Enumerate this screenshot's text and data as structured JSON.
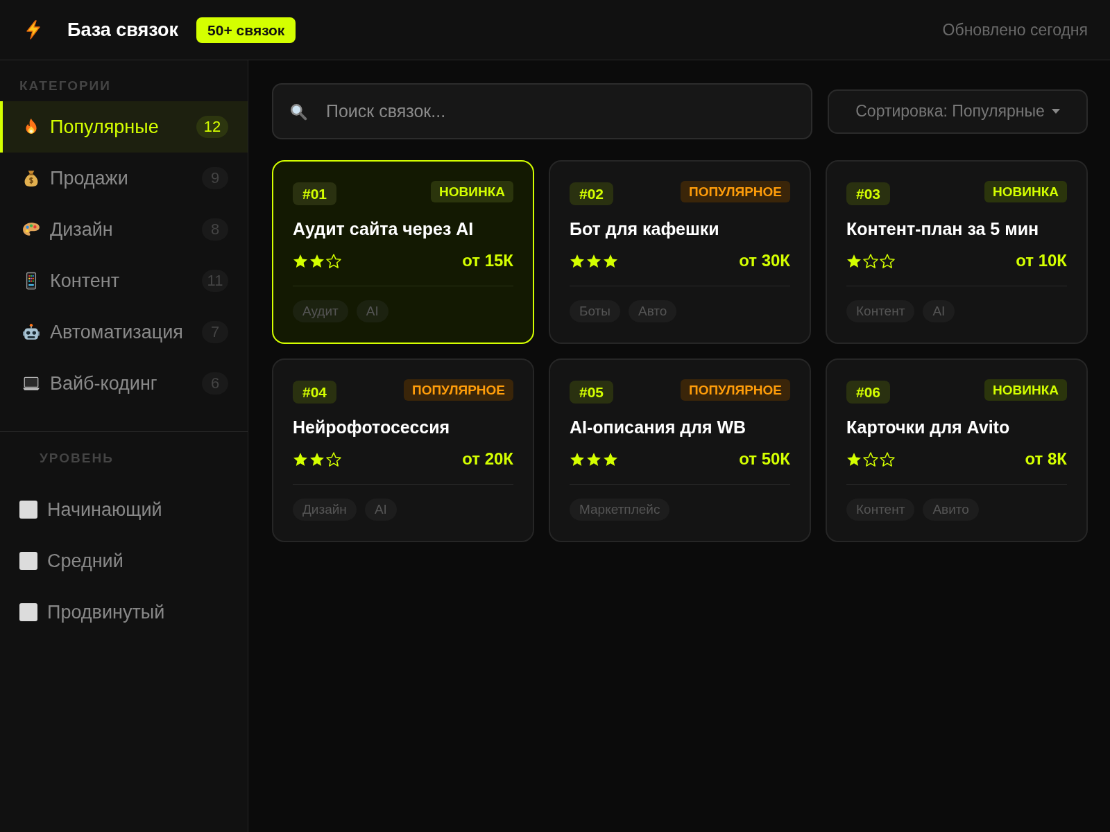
{
  "header": {
    "title": "База связок",
    "badge": "50+ связок",
    "status": "Обновлено сегодня"
  },
  "sidebar": {
    "categories_heading": "КАТЕГОРИИ",
    "categories": [
      {
        "label": "Популярные",
        "count": "12",
        "selected": true
      },
      {
        "label": "Продажи",
        "count": "9",
        "selected": false
      },
      {
        "label": "Дизайн",
        "count": "8",
        "selected": false
      },
      {
        "label": "Контент",
        "count": "11",
        "selected": false
      },
      {
        "label": "Автоматизация",
        "count": "7",
        "selected": false
      },
      {
        "label": "Вайб-кодинг",
        "count": "6",
        "selected": false
      }
    ],
    "levels_heading": "УРОВЕНЬ",
    "levels": [
      {
        "label": "Начинающий",
        "checked": false
      },
      {
        "label": "Средний",
        "checked": false
      },
      {
        "label": "Продвинутый",
        "checked": false
      }
    ]
  },
  "search": {
    "placeholder": "Поиск связок..."
  },
  "sort": {
    "label": "Сортировка: Популярные"
  },
  "cards": [
    {
      "number": "#01",
      "badge": {
        "text": "НОВИНКА",
        "kind": "new"
      },
      "title": "Аудит сайта через AI",
      "stars": 2,
      "price": "от 15К",
      "tags": [
        "Аудит",
        "AI"
      ],
      "selected": true
    },
    {
      "number": "#02",
      "badge": {
        "text": "ПОПУЛЯРНОЕ",
        "kind": "popular"
      },
      "title": "Бот для кафешки",
      "stars": 3,
      "price": "от 30К",
      "tags": [
        "Боты",
        "Авто"
      ],
      "selected": false
    },
    {
      "number": "#03",
      "badge": {
        "text": "НОВИНКА",
        "kind": "new"
      },
      "title": "Контент-план за 5 мин",
      "stars": 1,
      "price": "от 10К",
      "tags": [
        "Контент",
        "AI"
      ],
      "selected": false
    },
    {
      "number": "#04",
      "badge": {
        "text": "ПОПУЛЯРНОЕ",
        "kind": "popular"
      },
      "title": "Нейрофотосессия",
      "stars": 2,
      "price": "от 20К",
      "tags": [
        "Дизайн",
        "AI"
      ],
      "selected": false
    },
    {
      "number": "#05",
      "badge": {
        "text": "ПОПУЛЯРНОЕ",
        "kind": "popular"
      },
      "title": "AI-описания для WB",
      "stars": 3,
      "price": "от 50К",
      "tags": [
        "Маркетплейс"
      ],
      "selected": false
    },
    {
      "number": "#06",
      "badge": {
        "text": "НОВИНКА",
        "kind": "new"
      },
      "title": "Карточки для Avito",
      "stars": 1,
      "price": "от 8К",
      "tags": [
        "Контент",
        "Авито"
      ],
      "selected": false
    }
  ]
}
